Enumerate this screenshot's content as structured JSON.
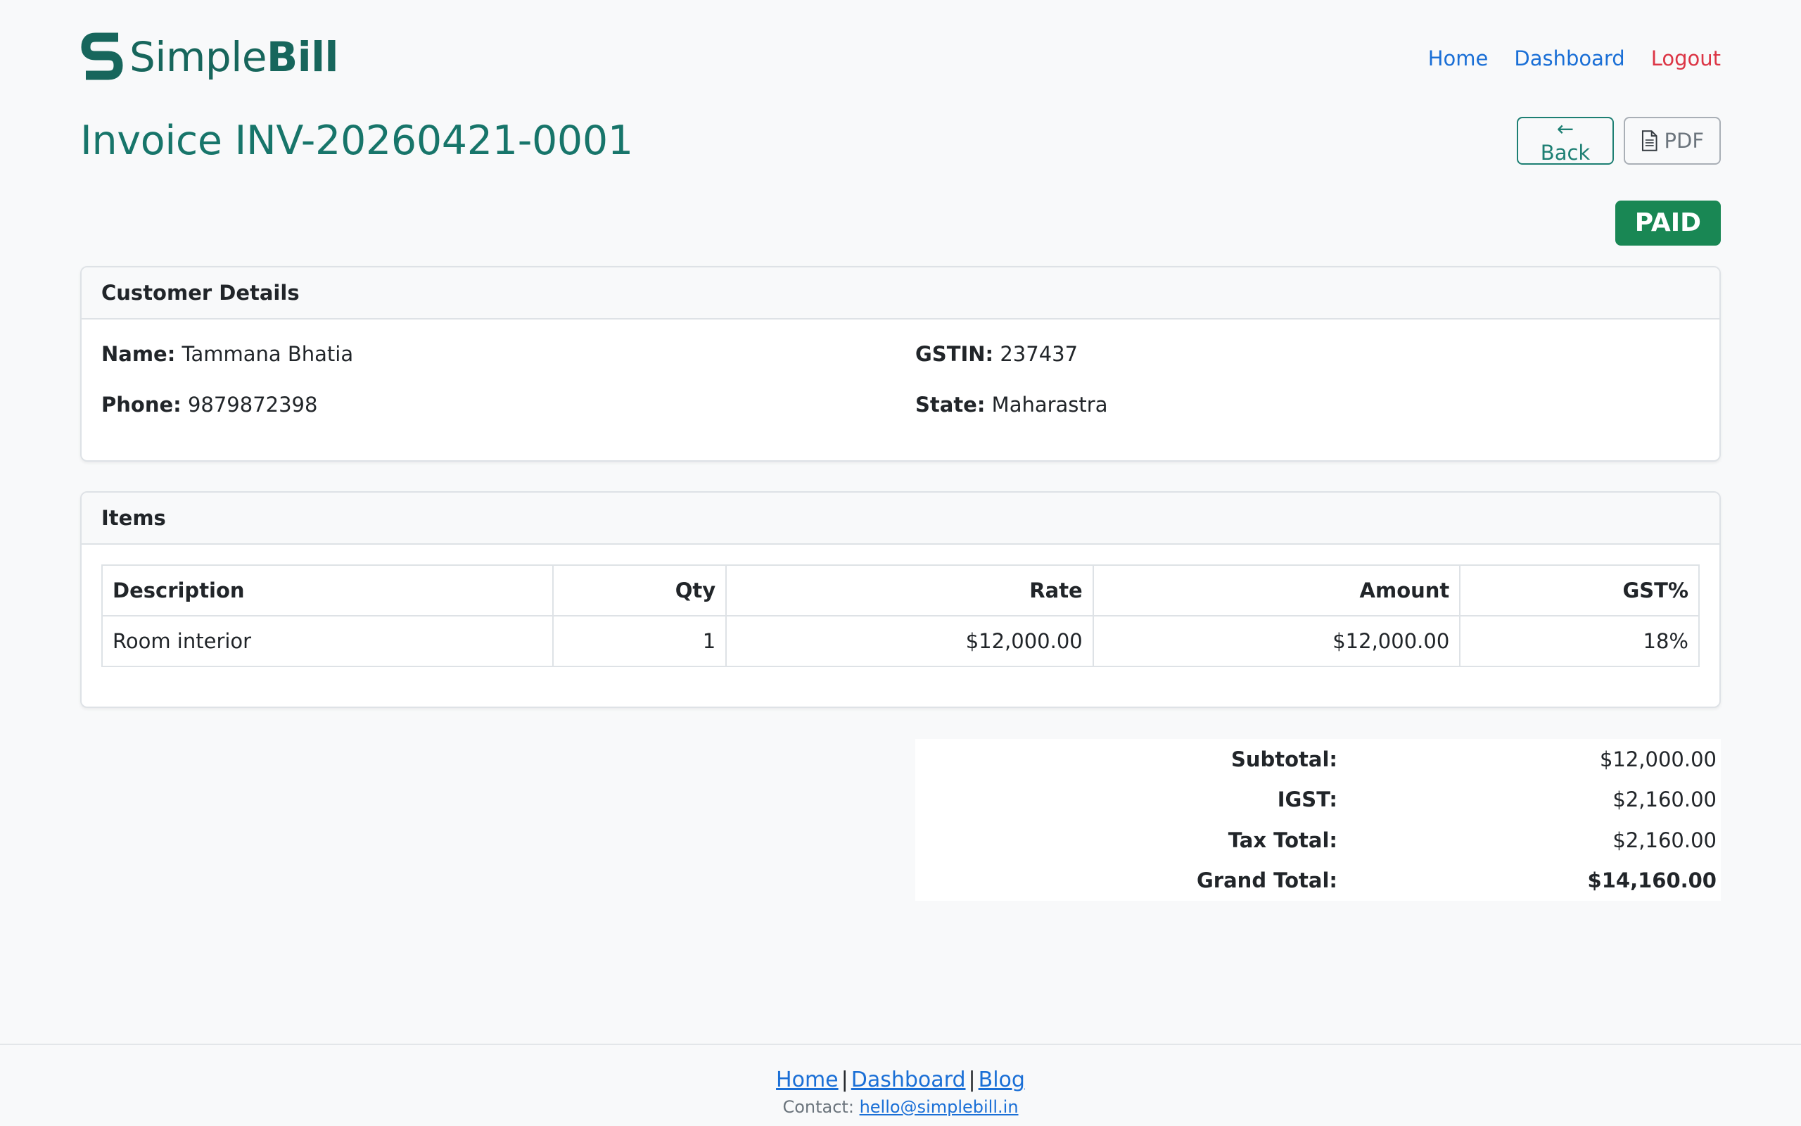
{
  "brand": {
    "name_part1": "Simple",
    "name_part2": "Bill",
    "logo_icon": "s-logo-icon",
    "color": "#17665c"
  },
  "nav": {
    "links": [
      {
        "label": "Home"
      },
      {
        "label": "Dashboard"
      },
      {
        "label": "Logout"
      }
    ]
  },
  "invoice": {
    "title": "Invoice INV-20260421-0001",
    "status": "PAID"
  },
  "actions": {
    "back_label": "← Back",
    "pdf_label": "PDF",
    "pdf_icon": "document-icon"
  },
  "customer": {
    "header": "Customer Details",
    "name_label": "Name:",
    "name": "Tammana Bhatia",
    "gstin_label": "GSTIN:",
    "gstin": "237437",
    "phone_label": "Phone:",
    "phone": "9879872398",
    "state_label": "State:",
    "state": "Maharastra"
  },
  "items": {
    "header": "Items",
    "columns": [
      "Description",
      "Qty",
      "Rate",
      "Amount",
      "GST%"
    ],
    "rows": [
      {
        "description": "Room interior",
        "qty": "1",
        "rate": "$12,000.00",
        "amount": "$12,000.00",
        "gst": "18%"
      }
    ]
  },
  "totals": {
    "subtotal_label": "Subtotal:",
    "subtotal": "$12,000.00",
    "igst_label": "IGST:",
    "igst": "$2,160.00",
    "tax_total_label": "Tax Total:",
    "tax_total": "$2,160.00",
    "grand_total_label": "Grand Total:",
    "grand_total": "$14,160.00"
  },
  "footer": {
    "links": [
      {
        "label": "Home"
      },
      {
        "label": "Dashboard"
      },
      {
        "label": "Blog"
      }
    ],
    "separator": "|",
    "contact_label": "Contact:",
    "contact_email": "hello@simplebill.in"
  },
  "colors": {
    "accent": "#17756a",
    "link": "#1a6fd6",
    "logout": "#dc3545",
    "paid": "#198754"
  }
}
